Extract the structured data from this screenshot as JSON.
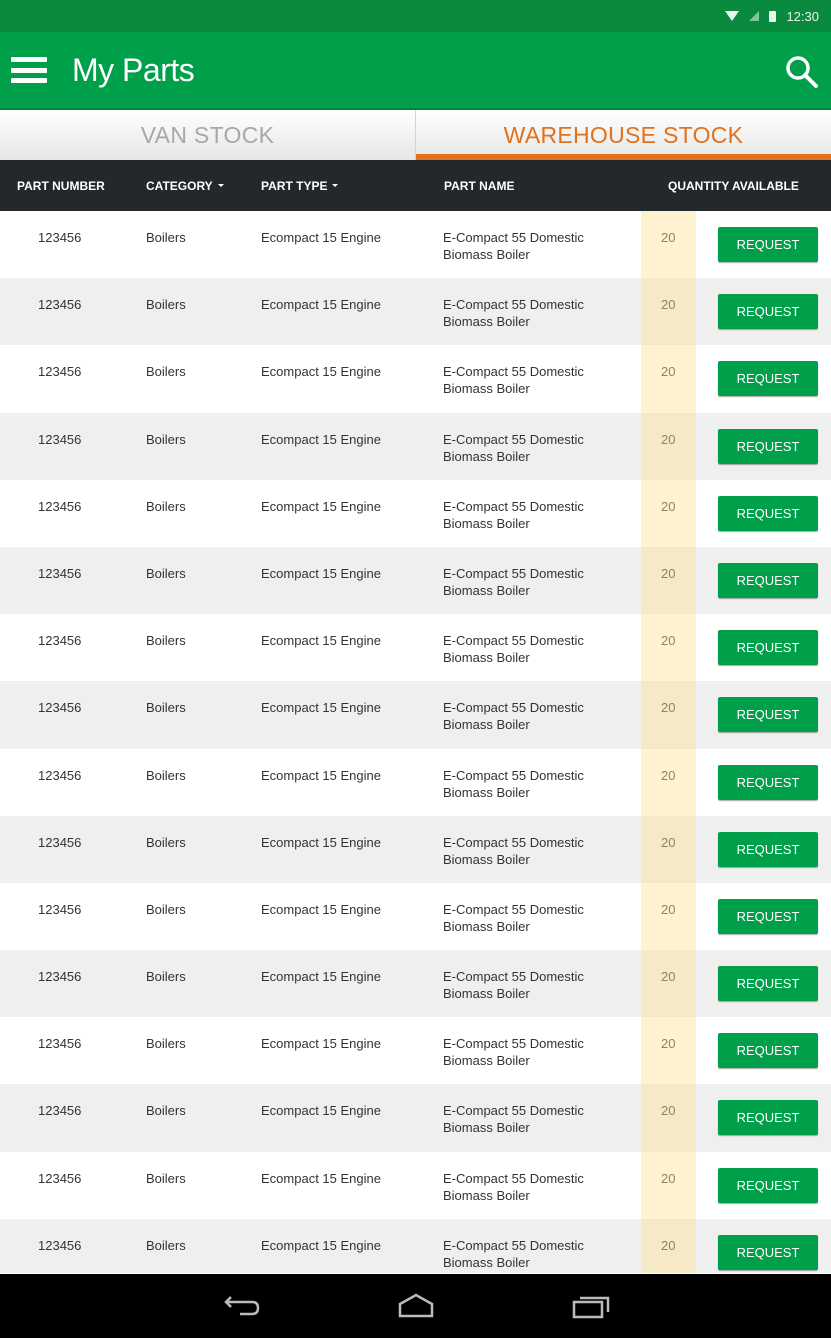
{
  "status_bar": {
    "time": "12:30"
  },
  "app_bar": {
    "title": "My Parts",
    "menu_icon": "hamburger-menu-icon",
    "search_icon": "search-icon"
  },
  "tabs": [
    {
      "label": "VAN STOCK",
      "active": false
    },
    {
      "label": "WAREHOUSE STOCK",
      "active": true
    }
  ],
  "colors": {
    "brand_green": "#00a04b",
    "accent_orange": "#e2711d",
    "header_dark": "#22282b",
    "qty_highlight": "#fdf0c8"
  },
  "table": {
    "columns": [
      {
        "label": "PART NUMBER",
        "sortable": false
      },
      {
        "label": "CATEGORY",
        "sortable": true
      },
      {
        "label": "PART TYPE",
        "sortable": true
      },
      {
        "label": "PART NAME",
        "sortable": false
      },
      {
        "label": "QUANTITY AVAILABLE",
        "sortable": false
      }
    ],
    "action_label": "REQUEST",
    "rows": [
      {
        "part_number": "123456",
        "category": "Boilers",
        "part_type": "Ecompact 15 Engine",
        "part_name_1": "E-Compact 55 Domestic",
        "part_name_2": "Biomass Boiler",
        "quantity": "20"
      },
      {
        "part_number": "123456",
        "category": "Boilers",
        "part_type": "Ecompact 15 Engine",
        "part_name_1": "E-Compact 55 Domestic",
        "part_name_2": "Biomass Boiler",
        "quantity": "20"
      },
      {
        "part_number": "123456",
        "category": "Boilers",
        "part_type": "Ecompact 15 Engine",
        "part_name_1": "E-Compact 55 Domestic",
        "part_name_2": "Biomass Boiler",
        "quantity": "20"
      },
      {
        "part_number": "123456",
        "category": "Boilers",
        "part_type": "Ecompact 15 Engine",
        "part_name_1": "E-Compact 55 Domestic",
        "part_name_2": "Biomass Boiler",
        "quantity": "20"
      },
      {
        "part_number": "123456",
        "category": "Boilers",
        "part_type": "Ecompact 15 Engine",
        "part_name_1": "E-Compact 55 Domestic",
        "part_name_2": "Biomass Boiler",
        "quantity": "20"
      },
      {
        "part_number": "123456",
        "category": "Boilers",
        "part_type": "Ecompact 15 Engine",
        "part_name_1": "E-Compact 55 Domestic",
        "part_name_2": "Biomass Boiler",
        "quantity": "20"
      },
      {
        "part_number": "123456",
        "category": "Boilers",
        "part_type": "Ecompact 15 Engine",
        "part_name_1": "E-Compact 55 Domestic",
        "part_name_2": "Biomass Boiler",
        "quantity": "20"
      },
      {
        "part_number": "123456",
        "category": "Boilers",
        "part_type": "Ecompact 15 Engine",
        "part_name_1": "E-Compact 55 Domestic",
        "part_name_2": "Biomass Boiler",
        "quantity": "20"
      },
      {
        "part_number": "123456",
        "category": "Boilers",
        "part_type": "Ecompact 15 Engine",
        "part_name_1": "E-Compact 55 Domestic",
        "part_name_2": "Biomass Boiler",
        "quantity": "20"
      },
      {
        "part_number": "123456",
        "category": "Boilers",
        "part_type": "Ecompact 15 Engine",
        "part_name_1": "E-Compact 55 Domestic",
        "part_name_2": "Biomass Boiler",
        "quantity": "20"
      },
      {
        "part_number": "123456",
        "category": "Boilers",
        "part_type": "Ecompact 15 Engine",
        "part_name_1": "E-Compact 55 Domestic",
        "part_name_2": "Biomass Boiler",
        "quantity": "20"
      },
      {
        "part_number": "123456",
        "category": "Boilers",
        "part_type": "Ecompact 15 Engine",
        "part_name_1": "E-Compact 55 Domestic",
        "part_name_2": "Biomass Boiler",
        "quantity": "20"
      },
      {
        "part_number": "123456",
        "category": "Boilers",
        "part_type": "Ecompact 15 Engine",
        "part_name_1": "E-Compact 55 Domestic",
        "part_name_2": "Biomass Boiler",
        "quantity": "20"
      },
      {
        "part_number": "123456",
        "category": "Boilers",
        "part_type": "Ecompact 15 Engine",
        "part_name_1": "E-Compact 55 Domestic",
        "part_name_2": "Biomass Boiler",
        "quantity": "20"
      },
      {
        "part_number": "123456",
        "category": "Boilers",
        "part_type": "Ecompact 15 Engine",
        "part_name_1": "E-Compact 55 Domestic",
        "part_name_2": "Biomass Boiler",
        "quantity": "20"
      },
      {
        "part_number": "123456",
        "category": "Boilers",
        "part_type": "Ecompact 15 Engine",
        "part_name_1": "E-Compact 55 Domestic",
        "part_name_2": "Biomass Boiler",
        "quantity": "20"
      }
    ]
  },
  "nav_bar": {
    "icons": [
      "back-icon",
      "home-icon",
      "recent-apps-icon"
    ]
  }
}
